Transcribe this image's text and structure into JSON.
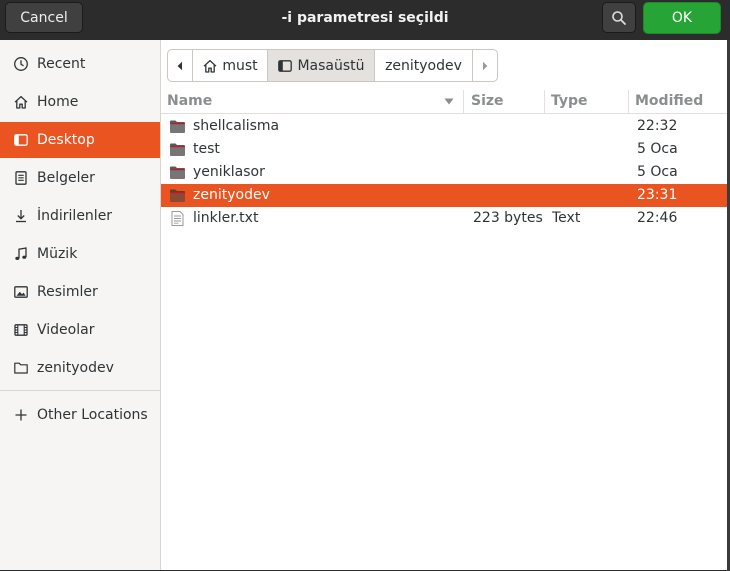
{
  "header": {
    "cancel_label": "Cancel",
    "title": "-i parametresi seçildi",
    "ok_label": "OK",
    "search_icon": "search-icon"
  },
  "sidebar": {
    "items": [
      {
        "label": "Recent",
        "icon": "clock-icon"
      },
      {
        "label": "Home",
        "icon": "home-icon"
      },
      {
        "label": "Desktop",
        "icon": "desktop-icon",
        "active": true
      },
      {
        "label": "Belgeler",
        "icon": "document-icon"
      },
      {
        "label": "İndirilenler",
        "icon": "download-icon"
      },
      {
        "label": "Müzik",
        "icon": "music-icon"
      },
      {
        "label": "Resimler",
        "icon": "image-icon"
      },
      {
        "label": "Videolar",
        "icon": "video-icon"
      },
      {
        "label": "zenityodev",
        "icon": "folder-icon"
      }
    ],
    "other_locations": "Other Locations"
  },
  "pathbar": {
    "segments": [
      "must",
      "Masaüstü",
      "zenityodev"
    ],
    "active": "Masaüstü"
  },
  "table": {
    "columns": [
      "Name",
      "Size",
      "Type",
      "Modified"
    ],
    "rows": [
      {
        "name": "shellcalisma",
        "size": "",
        "type": "",
        "modified": "22:32",
        "kind": "folder"
      },
      {
        "name": "test",
        "size": "",
        "type": "",
        "modified": "5 Oca",
        "kind": "folder"
      },
      {
        "name": "yeniklasor",
        "size": "",
        "type": "",
        "modified": "5 Oca",
        "kind": "folder"
      },
      {
        "name": "zenityodev",
        "size": "",
        "type": "",
        "modified": "23:31",
        "kind": "folder",
        "selected": true
      },
      {
        "name": "linkler.txt",
        "size": "223 bytes",
        "type": "Text",
        "modified": "22:46",
        "kind": "text"
      }
    ]
  },
  "colors": {
    "accent": "#e95420",
    "ok_button": "#26a435",
    "header": "#2c2c2c"
  }
}
